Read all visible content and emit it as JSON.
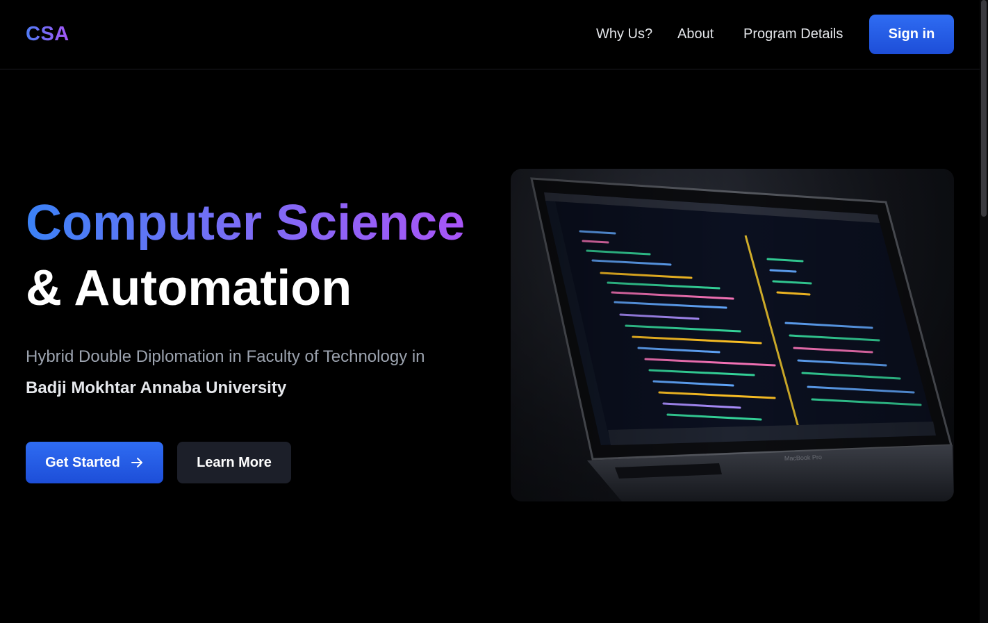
{
  "header": {
    "logo": "CSA",
    "nav": [
      {
        "label": "Why Us?"
      },
      {
        "label": "About"
      },
      {
        "label": "Program Details"
      }
    ],
    "signin_label": "Sign in"
  },
  "hero": {
    "title_line1": "Computer Science",
    "title_line2": "& Automation",
    "subtitle": "Hybrid Double Diplomation in Faculty of Technology in",
    "university": "Badji Mokhtar Annaba University",
    "primary_button": "Get Started",
    "secondary_button": "Learn More"
  },
  "icons": {
    "primary_button_icon": "arrow-right-icon"
  },
  "colors": {
    "background": "#000000",
    "accent_blue": "#2563eb",
    "accent_purple": "#a855f7",
    "secondary_button_bg": "#1c1f29"
  }
}
